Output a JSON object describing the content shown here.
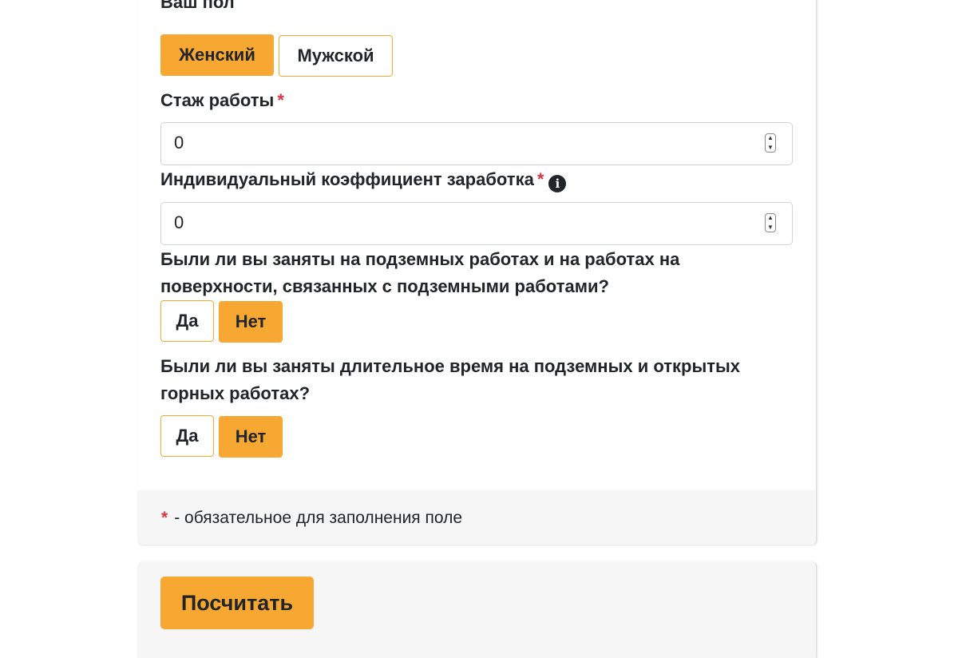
{
  "gender": {
    "label": "Ваш пол",
    "options": [
      {
        "label": "Женский",
        "selected": true
      },
      {
        "label": "Мужской",
        "selected": false
      }
    ]
  },
  "experience": {
    "label": "Стаж работы",
    "required_mark": "*",
    "value": "0",
    "icon": "spinner-icon"
  },
  "coefficient": {
    "label": "Индивидуальный коэффициент заработка",
    "required_mark": "*",
    "info_icon": "i",
    "value": "0",
    "icon": "spinner-icon"
  },
  "underground": {
    "label_line1": "Были ли вы заняты на подземных работах и на работах на",
    "label_line2": "поверхности, связанных с подземными работами?",
    "options": [
      {
        "label": "Да",
        "selected": false
      },
      {
        "label": "Нет",
        "selected": true
      }
    ]
  },
  "mining": {
    "label_line1": "Были ли вы заняты длительное время на подземных и открытых",
    "label_line2": "горных работах?",
    "options": [
      {
        "label": "Да",
        "selected": false
      },
      {
        "label": "Нет",
        "selected": true
      }
    ]
  },
  "footer": {
    "required_mark": "*",
    "note": "- обязательное для заполнения поле"
  },
  "submit": {
    "label": "Посчитать"
  },
  "colors": {
    "accent": "#f6a832",
    "required": "#dc3545",
    "text": "#212529",
    "footer_bg": "#f6f6f6"
  }
}
